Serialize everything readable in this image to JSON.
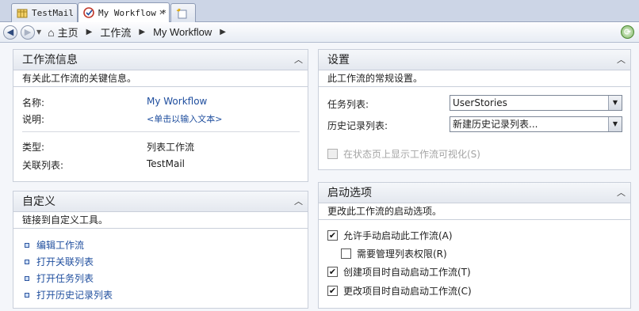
{
  "tabs": [
    {
      "label": "TestMail",
      "active": false,
      "icon": "list-icon"
    },
    {
      "label": "My Workflow *",
      "active": true,
      "icon": "workflow-icon"
    },
    {
      "label": "",
      "active": false,
      "icon": "new-tab-icon"
    }
  ],
  "nav": {
    "breadcrumbs": [
      "主页",
      "工作流",
      "My Workflow"
    ]
  },
  "workflow_info": {
    "title": "工作流信息",
    "description": "有关此工作流的关键信息。",
    "name_label": "名称:",
    "name_value": "My Workflow",
    "desc_label": "说明:",
    "desc_value": "<单击以输入文本>",
    "type_label": "类型:",
    "type_value": "列表工作流",
    "list_label": "关联列表:",
    "list_value": "TestMail"
  },
  "customize": {
    "title": "自定义",
    "description": "链接到自定义工具。",
    "links": [
      "编辑工作流",
      "打开关联列表",
      "打开任务列表",
      "打开历史记录列表"
    ]
  },
  "settings": {
    "title": "设置",
    "description": "此工作流的常规设置。",
    "task_list_label": "任务列表:",
    "task_list_value": "UserStories",
    "history_list_label": "历史记录列表:",
    "history_list_value": "新建历史记录列表...",
    "show_visual_label": "在状态页上显示工作流可视化(S)"
  },
  "start_options": {
    "title": "启动选项",
    "description": "更改此工作流的启动选项。",
    "options": [
      {
        "label": "允许手动启动此工作流(A)",
        "checked": true
      },
      {
        "label": "需要管理列表权限(R)",
        "checked": false
      },
      {
        "label": "创建项目时自动启动工作流(T)",
        "checked": true
      },
      {
        "label": "更改项目时自动启动工作流(C)",
        "checked": true
      }
    ]
  },
  "colors": {
    "link": "#1f4e9e",
    "panel_header": "#e4e8ef",
    "background": "#f4f6fa"
  }
}
